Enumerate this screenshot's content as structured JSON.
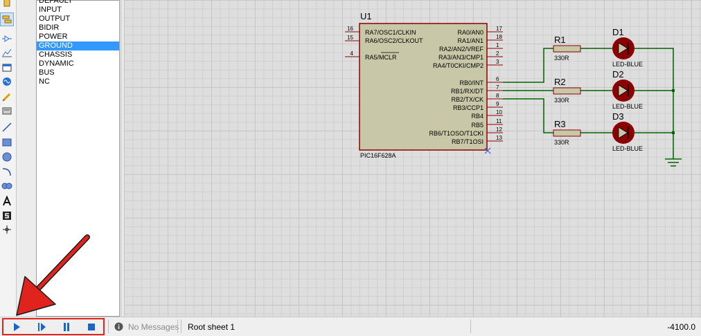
{
  "device_list": {
    "items": [
      "DEFAULT",
      "INPUT",
      "OUTPUT",
      "BIDIR",
      "POWER",
      "GROUND",
      "CHASSIS",
      "DYNAMIC",
      "BUS",
      "NC"
    ],
    "selected_index": 5
  },
  "schematic": {
    "u1": {
      "ref": "U1",
      "part": "PIC16F628A",
      "left_pins": [
        {
          "num": "16",
          "label": "RA7/OSC1/CLKIN"
        },
        {
          "num": "15",
          "label": "RA6/OSC2/CLKOUT"
        },
        {
          "num": "4",
          "label": "RA5/MCLR"
        }
      ],
      "right_pins": [
        {
          "num": "17",
          "label": "RA0/AN0"
        },
        {
          "num": "18",
          "label": "RA1/AN1"
        },
        {
          "num": "1",
          "label": "RA2/AN2/VREF"
        },
        {
          "num": "2",
          "label": "RA3/AN3/CMP1"
        },
        {
          "num": "3",
          "label": "RA4/T0CKI/CMP2"
        },
        {
          "num": "6",
          "label": "RB0/INT"
        },
        {
          "num": "7",
          "label": "RB1/RX/DT"
        },
        {
          "num": "8",
          "label": "RB2/TX/CK"
        },
        {
          "num": "9",
          "label": "RB3/CCP1"
        },
        {
          "num": "10",
          "label": "RB4"
        },
        {
          "num": "11",
          "label": "RB5"
        },
        {
          "num": "12",
          "label": "RB6/T1OSO/T1CKI"
        },
        {
          "num": "13",
          "label": "RB7/T1OSI"
        }
      ]
    },
    "resistors": [
      {
        "ref": "R1",
        "value": "330R"
      },
      {
        "ref": "R2",
        "value": "330R"
      },
      {
        "ref": "R3",
        "value": "330R"
      }
    ],
    "leds": [
      {
        "ref": "D1",
        "value": "LED-BLUE"
      },
      {
        "ref": "D2",
        "value": "LED-BLUE"
      },
      {
        "ref": "D3",
        "value": "LED-BLUE"
      }
    ]
  },
  "status": {
    "messages": "No Messages",
    "sheet": "Root sheet 1",
    "coordinate": "-4100.0"
  },
  "colors": {
    "wire": "#006400",
    "component_body": "#c8c7a7",
    "component_outline": "#8b0000",
    "highlight_box": "#e0231c",
    "arrow": "#e0231c",
    "list_selection": "#3399ff"
  }
}
